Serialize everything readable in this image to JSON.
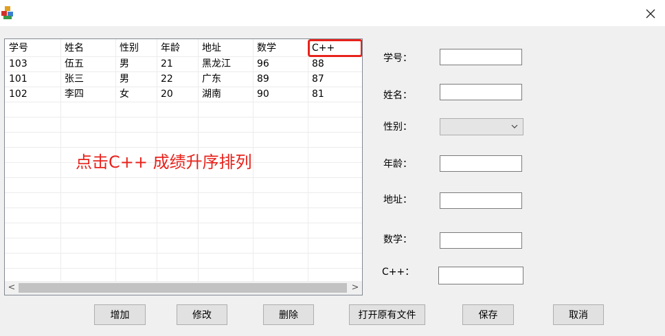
{
  "window": {
    "close_glyph": "✕"
  },
  "table": {
    "columns": [
      "学号",
      "姓名",
      "性别",
      "年龄",
      "地址",
      "数学",
      "C++"
    ],
    "rows": [
      [
        "103",
        "伍五",
        "男",
        "21",
        "黑龙江",
        "96",
        "88"
      ],
      [
        "101",
        "张三",
        "男",
        "22",
        "广东",
        "89",
        "87"
      ],
      [
        "102",
        "李四",
        "女",
        "20",
        "湖南",
        "90",
        "81"
      ]
    ],
    "scroll_left": "<",
    "scroll_right": ">"
  },
  "annotation": "点击C++ 成绩升序排列",
  "form": {
    "id_label": "学号：",
    "name_label": "姓名：",
    "gender_label": "性别：",
    "age_label": "年龄：",
    "address_label": "地址：",
    "math_label": "数学：",
    "cpp_label": "C++："
  },
  "buttons": {
    "add": "增加",
    "edit": "修改",
    "delete": "删除",
    "open": "打开原有文件",
    "save": "保存",
    "cancel": "取消"
  },
  "colors": {
    "highlight": "#e8221b",
    "annotation": "#e8221b"
  },
  "icons": {
    "app": "app-icon",
    "close": "close-icon",
    "dropdown": "chevron-down-icon"
  }
}
